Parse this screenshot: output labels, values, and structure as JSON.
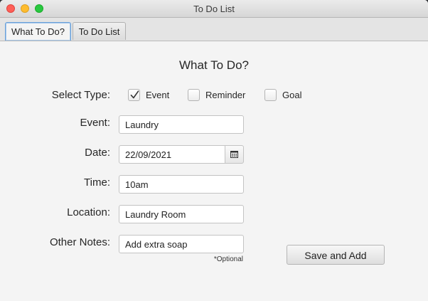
{
  "window": {
    "title": "To Do List"
  },
  "tabs": [
    {
      "label": "What To Do?",
      "selected": true
    },
    {
      "label": "To Do List",
      "selected": false
    }
  ],
  "form": {
    "heading": "What To Do?",
    "select_type_label": "Select Type:",
    "types": [
      {
        "label": "Event",
        "checked": true
      },
      {
        "label": "Reminder",
        "checked": false
      },
      {
        "label": "Goal",
        "checked": false
      }
    ],
    "event_label": "Event:",
    "event_value": "Laundry",
    "date_label": "Date:",
    "date_value": "22/09/2021",
    "time_label": "Time:",
    "time_value": "10am",
    "location_label": "Location:",
    "location_value": "Laundry Room",
    "notes_label": "Other Notes:",
    "notes_value": "Add extra soap",
    "optional_text": "*Optional",
    "save_label": "Save and Add"
  }
}
